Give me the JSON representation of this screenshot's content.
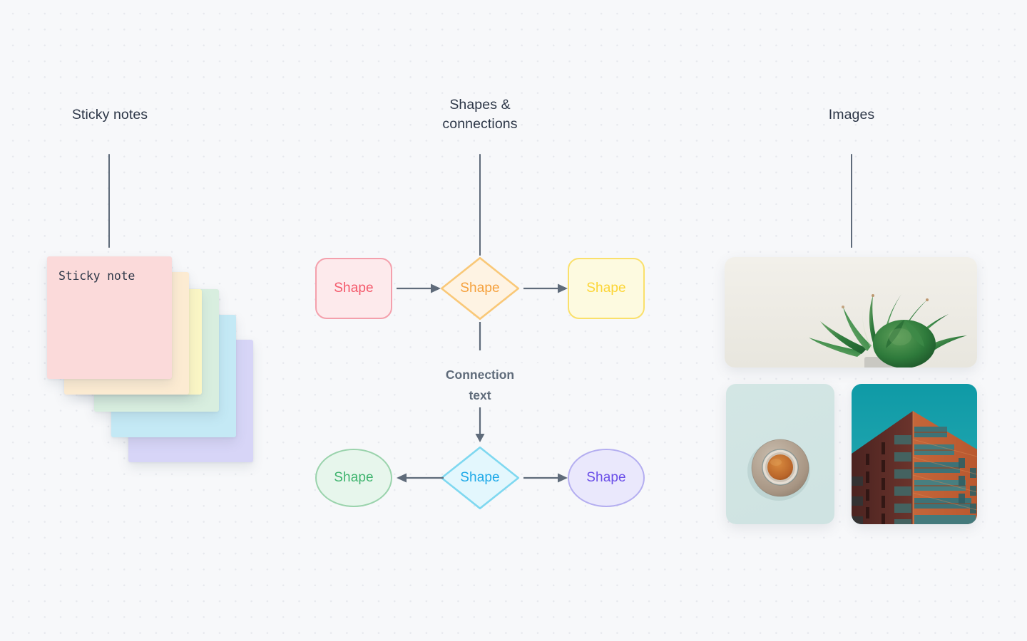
{
  "canvas": {
    "background_color": "#F7F8FA",
    "dot_color": "#E7E9EE"
  },
  "sections": {
    "sticky": {
      "title": "Sticky notes",
      "note_text": "Sticky note",
      "note_colors": [
        "#FBDADA",
        "#FCEBD2",
        "#FBF6C5",
        "#D8EEDF",
        "#C4E9F5",
        "#D7D5F7"
      ],
      "note_count": 6
    },
    "shapes": {
      "title": "Shapes &\nconnections",
      "connection_text": "Connection\ntext",
      "edge_color": "#5F6B7A",
      "nodes": [
        {
          "id": "a",
          "label": "Shape",
          "shape": "rounded-rectangle",
          "fill": "#FDEAEC",
          "stroke": "#F4A0AC",
          "text_color": "#F4596B"
        },
        {
          "id": "b",
          "label": "Shape",
          "shape": "diamond",
          "fill": "#FEF3E3",
          "stroke": "#F9C878",
          "text_color": "#F5A03C"
        },
        {
          "id": "c",
          "label": "Shape",
          "shape": "rounded-rectangle",
          "fill": "#FDFAE0",
          "stroke": "#FAE06B",
          "text_color": "#FCD535"
        },
        {
          "id": "d",
          "label": "Shape",
          "shape": "ellipse",
          "fill": "#E7F6EC",
          "stroke": "#9AD3AC",
          "text_color": "#3FB46E"
        },
        {
          "id": "e",
          "label": "Shape",
          "shape": "diamond",
          "fill": "#E3F7FD",
          "stroke": "#7FD8F0",
          "text_color": "#1EA9E8"
        },
        {
          "id": "f",
          "label": "Shape",
          "shape": "ellipse",
          "fill": "#EAE8FC",
          "stroke": "#B4AEF0",
          "text_color": "#6A4EE8"
        }
      ]
    },
    "images": {
      "title": "Images",
      "photos": [
        {
          "id": "plant",
          "subject": "succulent plant on cream background"
        },
        {
          "id": "coffee",
          "subject": "cup of coffee on saucer, top down, mint background"
        },
        {
          "id": "building",
          "subject": "brick apartment building corner against teal sky"
        }
      ]
    }
  }
}
